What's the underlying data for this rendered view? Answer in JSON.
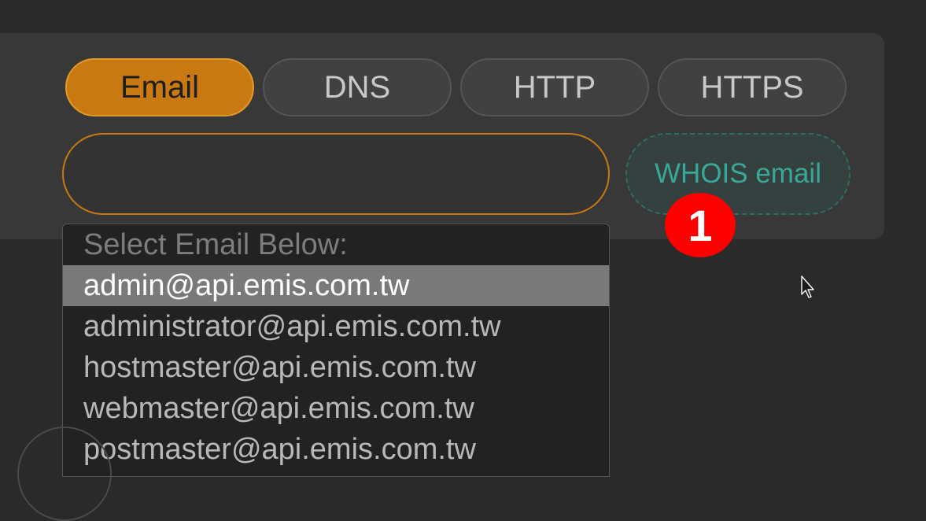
{
  "tabs": [
    {
      "label": "Email",
      "active": true
    },
    {
      "label": "DNS",
      "active": false
    },
    {
      "label": "HTTP",
      "active": false
    },
    {
      "label": "HTTPS",
      "active": false
    }
  ],
  "email_input": {
    "value": ""
  },
  "whois_button": {
    "label": "WHOIS email"
  },
  "badge": {
    "label": "1"
  },
  "dropdown": {
    "header": "Select Email Below:",
    "options": [
      "admin@api.emis.com.tw",
      "administrator@api.emis.com.tw",
      "hostmaster@api.emis.com.tw",
      "webmaster@api.emis.com.tw",
      "postmaster@api.emis.com.tw"
    ],
    "selected_index": 0
  },
  "colors": {
    "accent": "#c87912",
    "whois_text": "#3aa898",
    "badge": "#ff0000",
    "background": "#2a2a2a"
  },
  "icons": {
    "cursor": "mouse-pointer-icon"
  }
}
